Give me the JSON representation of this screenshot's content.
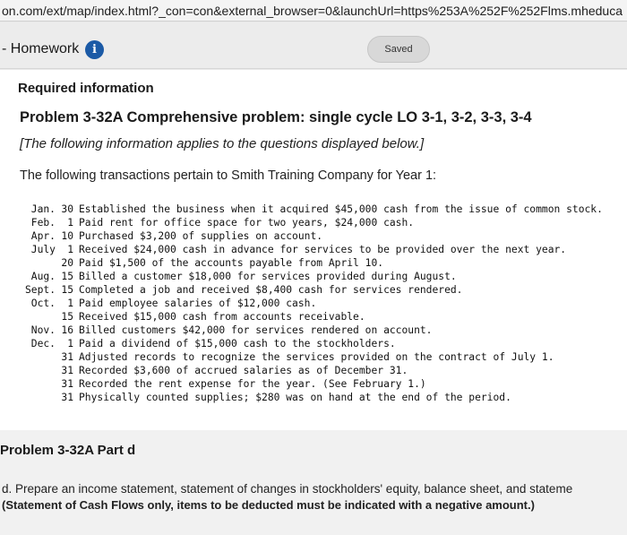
{
  "browser": {
    "url": "on.com/ext/map/index.html?_con=con&external_browser=0&launchUrl=https%253A%252F%252Flms.mheduca"
  },
  "header": {
    "title": "- Homework",
    "info_icon": "i",
    "saved_label": "Saved"
  },
  "main": {
    "required_info": "Required information",
    "problem_title": "Problem 3-32A Comprehensive problem: single cycle LO 3-1, 3-2, 3-3, 3-4",
    "applies_note": "[The following information applies to the questions displayed below.]",
    "intro": "The following transactions pertain to Smith Training Company for Year 1:",
    "transactions": [
      {
        "month": "Jan.",
        "day": "30",
        "desc": "Established the business when it acquired $45,000 cash from the issue of common stock."
      },
      {
        "month": "Feb.",
        "day": "1",
        "desc": "Paid rent for office space for two years, $24,000 cash."
      },
      {
        "month": "Apr.",
        "day": "10",
        "desc": "Purchased $3,200 of supplies on account."
      },
      {
        "month": "July",
        "day": "1",
        "desc": "Received $24,000 cash in advance for services to be provided over the next year."
      },
      {
        "month": "",
        "day": "20",
        "desc": "Paid $1,500 of the accounts payable from April 10."
      },
      {
        "month": "Aug.",
        "day": "15",
        "desc": "Billed a customer $18,000 for services provided during August."
      },
      {
        "month": "Sept.",
        "day": "15",
        "desc": "Completed a job and received $8,400 cash for services rendered."
      },
      {
        "month": "Oct.",
        "day": "1",
        "desc": "Paid employee salaries of $12,000 cash."
      },
      {
        "month": "",
        "day": "15",
        "desc": "Received $15,000 cash from accounts receivable."
      },
      {
        "month": "Nov.",
        "day": "16",
        "desc": "Billed customers $42,000 for services rendered on account."
      },
      {
        "month": "Dec.",
        "day": "1",
        "desc": "Paid a dividend of $15,000 cash to the stockholders."
      },
      {
        "month": "",
        "day": "31",
        "desc": "Adjusted records to recognize the services provided on the contract of July 1."
      },
      {
        "month": "",
        "day": "31",
        "desc": "Recorded $3,600 of accrued salaries as of December 31."
      },
      {
        "month": "",
        "day": "31",
        "desc": "Recorded the rent expense for the year. (See February 1.)"
      },
      {
        "month": "",
        "day": "31",
        "desc": "Physically counted supplies; $280 was on hand at the end of the period."
      }
    ]
  },
  "part": {
    "title": "Problem 3-32A Part d",
    "text": "d. Prepare an income statement, statement of changes in stockholders' equity, balance sheet, and stateme",
    "note": "(Statement of Cash Flows only, items to be deducted must be indicated with a negative amount.)"
  },
  "colors": {
    "info_icon_bg": "#1b5aa6",
    "page_bg": "#e9e9e9",
    "card_bg": "#ffffff"
  }
}
